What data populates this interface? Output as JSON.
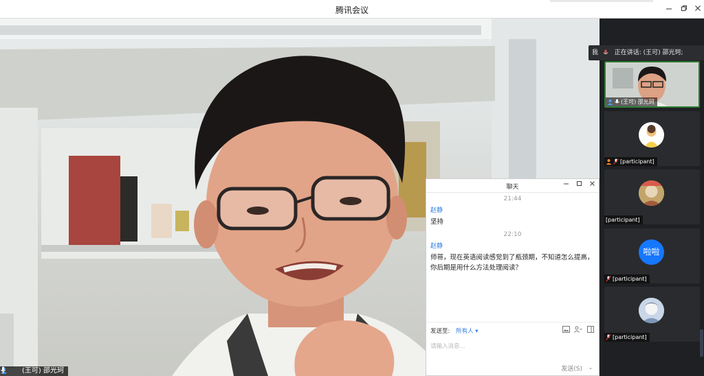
{
  "window": {
    "title": "腾讯会议",
    "controls": [
      "minimize",
      "restore",
      "close"
    ]
  },
  "main_video": {
    "speaker_label": "(王可) 邵光珂"
  },
  "sidebar": {
    "me_label": "我",
    "speaking_text": "正在讲话: (王可) 邵光珂;",
    "participants": [
      {
        "name": "(王可) 邵光珂",
        "kind": "video",
        "active": true
      },
      {
        "name": "[participant]",
        "kind": "avatar-image"
      },
      {
        "name": "[participant]",
        "kind": "avatar-image"
      },
      {
        "name": "[participant]",
        "kind": "avatar-text",
        "avatar_text": "啦啦"
      },
      {
        "name": "[participant]",
        "kind": "avatar-image"
      }
    ]
  },
  "chat": {
    "title": "聊天",
    "messages": [
      {
        "time": "21:44",
        "sender": "赵静",
        "text": "坚持"
      },
      {
        "time": "22:10",
        "sender": "赵静",
        "text": "师哥，现在英语阅读感觉到了瓶颈期，不知道怎么提高，你后期是用什么方法处理阅读？"
      }
    ],
    "send_to_label": "发送至:",
    "recipient": "所有人",
    "input_placeholder": "请输入消息...",
    "send_label": "发送(S)"
  },
  "colors": {
    "accent": "#2f7de1",
    "active_border": "#2e7d32",
    "avatar_blue": "#1677ff",
    "bg_dark": "#1f2023"
  }
}
